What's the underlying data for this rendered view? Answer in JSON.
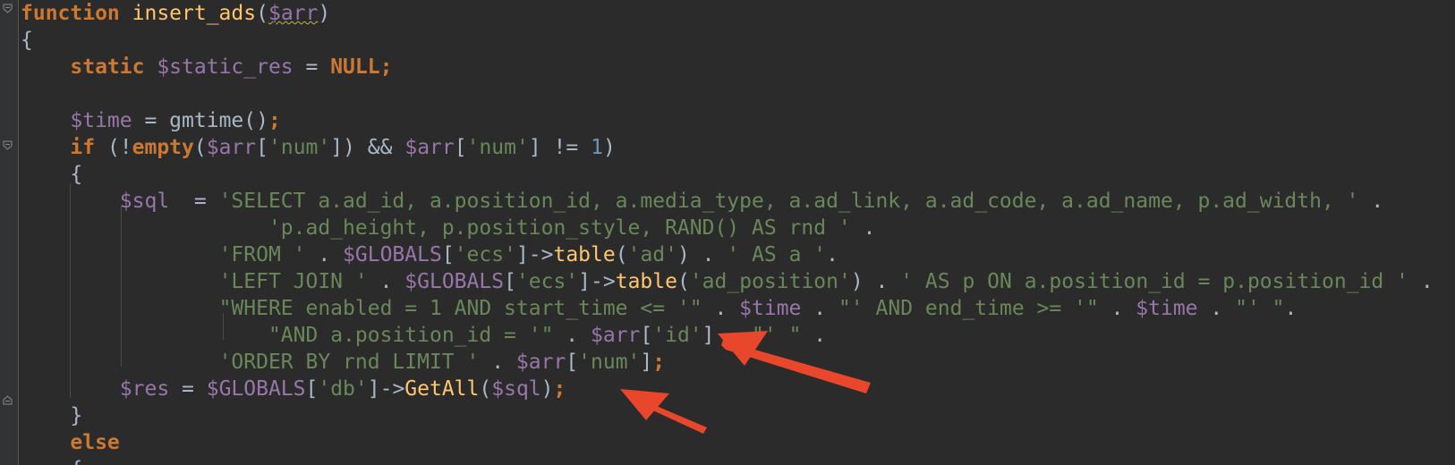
{
  "colors": {
    "background": "#2b2b2b",
    "gutter": "#313335",
    "keyword": "#cc7832",
    "variable": "#9876aa",
    "string": "#6a8759",
    "function": "#ffc66d",
    "plain": "#a9b7c6",
    "number": "#6897bb",
    "annotation_arrow": "#e8472b"
  },
  "icons": [
    "fold-marker-icon",
    "red-arrow-icon"
  ],
  "lines": [
    {
      "tokens": [
        {
          "t": "function ",
          "c": "kw"
        },
        {
          "t": "insert_ads",
          "c": "fn"
        },
        {
          "t": "(",
          "c": "pl"
        },
        {
          "t": "$arr",
          "c": "var",
          "sq": true
        },
        {
          "t": ")",
          "c": "pl"
        }
      ]
    },
    {
      "tokens": [
        {
          "t": "{",
          "c": "pl"
        }
      ]
    },
    {
      "tokens": [
        {
          "t": "    ",
          "c": "pl"
        },
        {
          "t": "static ",
          "c": "kw"
        },
        {
          "t": "$static_res",
          "c": "var"
        },
        {
          "t": " = ",
          "c": "pl"
        },
        {
          "t": "NULL;",
          "c": "kw"
        }
      ]
    },
    {
      "tokens": []
    },
    {
      "tokens": [
        {
          "t": "    ",
          "c": "pl"
        },
        {
          "t": "$time",
          "c": "var"
        },
        {
          "t": " = gmtime()",
          "c": "pl"
        },
        {
          "t": ";",
          "c": "kw"
        }
      ]
    },
    {
      "tokens": [
        {
          "t": "    ",
          "c": "pl"
        },
        {
          "t": "if ",
          "c": "kw"
        },
        {
          "t": "(!",
          "c": "pl"
        },
        {
          "t": "empty",
          "c": "kw"
        },
        {
          "t": "(",
          "c": "pl"
        },
        {
          "t": "$arr",
          "c": "var"
        },
        {
          "t": "[",
          "c": "pl"
        },
        {
          "t": "'num'",
          "c": "str"
        },
        {
          "t": "]) && ",
          "c": "pl"
        },
        {
          "t": "$arr",
          "c": "var"
        },
        {
          "t": "[",
          "c": "pl"
        },
        {
          "t": "'num'",
          "c": "str"
        },
        {
          "t": "] != ",
          "c": "pl"
        },
        {
          "t": "1",
          "c": "num"
        },
        {
          "t": ")",
          "c": "pl"
        }
      ]
    },
    {
      "tokens": [
        {
          "t": "    {",
          "c": "pl"
        }
      ]
    },
    {
      "tokens": [
        {
          "t": "        ",
          "c": "pl"
        },
        {
          "t": "$sql",
          "c": "var"
        },
        {
          "t": "  = ",
          "c": "pl"
        },
        {
          "t": "'SELECT a.ad_id, a.position_id, a.media_type, a.ad_link, a.ad_code, a.ad_name, p.ad_width, '",
          "c": "str"
        },
        {
          "t": " .",
          "c": "pl"
        }
      ]
    },
    {
      "tokens": [
        {
          "t": "                    ",
          "c": "pl"
        },
        {
          "t": "'p.ad_height, p.position_style, RAND() AS rnd '",
          "c": "str"
        },
        {
          "t": " .",
          "c": "pl"
        }
      ]
    },
    {
      "tokens": [
        {
          "t": "                ",
          "c": "pl"
        },
        {
          "t": "'FROM '",
          "c": "str"
        },
        {
          "t": " . ",
          "c": "pl"
        },
        {
          "t": "$GLOBALS",
          "c": "var"
        },
        {
          "t": "[",
          "c": "pl"
        },
        {
          "t": "'ecs'",
          "c": "str"
        },
        {
          "t": "]->",
          "c": "pl"
        },
        {
          "t": "table",
          "c": "fn"
        },
        {
          "t": "(",
          "c": "pl"
        },
        {
          "t": "'ad'",
          "c": "str"
        },
        {
          "t": ") . ",
          "c": "pl"
        },
        {
          "t": "' AS a '",
          "c": "str"
        },
        {
          "t": ".",
          "c": "pl"
        }
      ]
    },
    {
      "tokens": [
        {
          "t": "                ",
          "c": "pl"
        },
        {
          "t": "'LEFT JOIN '",
          "c": "str"
        },
        {
          "t": " . ",
          "c": "pl"
        },
        {
          "t": "$GLOBALS",
          "c": "var"
        },
        {
          "t": "[",
          "c": "pl"
        },
        {
          "t": "'ecs'",
          "c": "str"
        },
        {
          "t": "]->",
          "c": "pl"
        },
        {
          "t": "table",
          "c": "fn"
        },
        {
          "t": "(",
          "c": "pl"
        },
        {
          "t": "'ad_position'",
          "c": "str"
        },
        {
          "t": ") . ",
          "c": "pl"
        },
        {
          "t": "' AS p ON a.position_id = p.position_id '",
          "c": "str"
        },
        {
          "t": " .",
          "c": "pl"
        }
      ]
    },
    {
      "tokens": [
        {
          "t": "                ",
          "c": "pl"
        },
        {
          "t": "\"WHERE enabled = 1 AND start_time <= '\"",
          "c": "str"
        },
        {
          "t": " . ",
          "c": "pl"
        },
        {
          "t": "$time",
          "c": "var"
        },
        {
          "t": " . ",
          "c": "pl"
        },
        {
          "t": "\"' AND end_time >= '\"",
          "c": "str"
        },
        {
          "t": " . ",
          "c": "pl"
        },
        {
          "t": "$time",
          "c": "var"
        },
        {
          "t": " . ",
          "c": "pl"
        },
        {
          "t": "\"' \"",
          "c": "str"
        },
        {
          "t": ".",
          "c": "pl"
        }
      ]
    },
    {
      "tokens": [
        {
          "t": "                    ",
          "c": "pl"
        },
        {
          "t": "\"AND a.position_id = '\"",
          "c": "str"
        },
        {
          "t": " . ",
          "c": "pl"
        },
        {
          "t": "$arr",
          "c": "var"
        },
        {
          "t": "[",
          "c": "pl"
        },
        {
          "t": "'id'",
          "c": "str"
        },
        {
          "t": "] . ",
          "c": "pl"
        },
        {
          "t": "\"' \"",
          "c": "str"
        },
        {
          "t": " .",
          "c": "pl"
        }
      ]
    },
    {
      "tokens": [
        {
          "t": "                ",
          "c": "pl"
        },
        {
          "t": "'ORDER BY rnd LIMIT '",
          "c": "str"
        },
        {
          "t": " . ",
          "c": "pl"
        },
        {
          "t": "$arr",
          "c": "var"
        },
        {
          "t": "[",
          "c": "pl"
        },
        {
          "t": "'num'",
          "c": "str"
        },
        {
          "t": "]",
          "c": "pl"
        },
        {
          "t": ";",
          "c": "kw"
        }
      ]
    },
    {
      "tokens": [
        {
          "t": "        ",
          "c": "pl"
        },
        {
          "t": "$res",
          "c": "var"
        },
        {
          "t": " = ",
          "c": "pl"
        },
        {
          "t": "$GLOBALS",
          "c": "var"
        },
        {
          "t": "[",
          "c": "pl"
        },
        {
          "t": "'db'",
          "c": "str"
        },
        {
          "t": "]->",
          "c": "pl"
        },
        {
          "t": "GetAll",
          "c": "fn"
        },
        {
          "t": "(",
          "c": "pl"
        },
        {
          "t": "$sql",
          "c": "var"
        },
        {
          "t": ")",
          "c": "pl"
        },
        {
          "t": ";",
          "c": "kw"
        }
      ]
    },
    {
      "tokens": [
        {
          "t": "    }",
          "c": "pl"
        }
      ]
    },
    {
      "tokens": [
        {
          "t": "    ",
          "c": "pl"
        },
        {
          "t": "else",
          "c": "kw"
        }
      ]
    },
    {
      "tokens": [
        {
          "t": "    {",
          "c": "pl"
        }
      ]
    }
  ]
}
